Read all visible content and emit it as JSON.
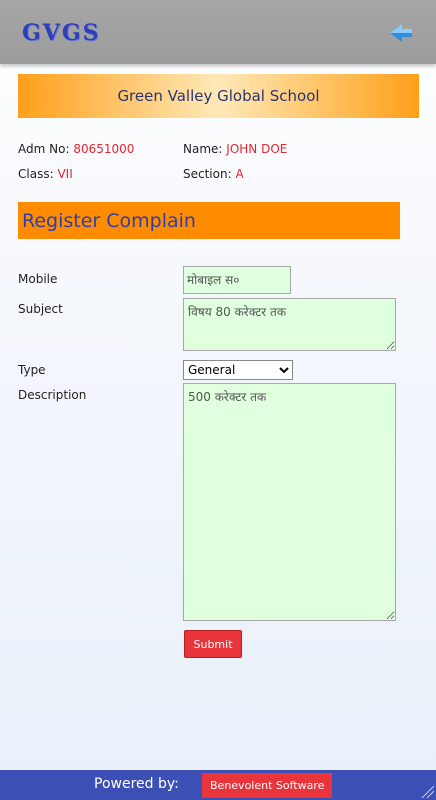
{
  "app": {
    "logo": "GVGS"
  },
  "banner": {
    "school_name": "Green Valley Global School"
  },
  "student": {
    "adm_label": "Adm No:",
    "adm_value": "80651000",
    "name_label": "Name:",
    "name_value": "JOHN DOE",
    "class_label": "Class:",
    "class_value": "VII",
    "section_label": "Section:",
    "section_value": "A"
  },
  "form": {
    "title": "Register Complain",
    "mobile_label": "Mobile",
    "mobile_placeholder": "मोबाइल स०",
    "subject_label": "Subject",
    "subject_placeholder": "विषय 80 करेक्टर तक",
    "type_label": "Type",
    "type_selected": "General",
    "description_label": "Description",
    "description_placeholder": "500 करेक्टर तक",
    "submit_label": "Submit"
  },
  "footer": {
    "powered_by": "Powered by:",
    "company": "Benevolent Software"
  },
  "colors": {
    "accent": "#ff8c00",
    "brand": "#2c3fb8",
    "footer": "#3b4fb5",
    "button": "#e8343a",
    "field_bg": "#dfffdf"
  },
  "icons": {
    "back": "back-arrow-icon"
  }
}
